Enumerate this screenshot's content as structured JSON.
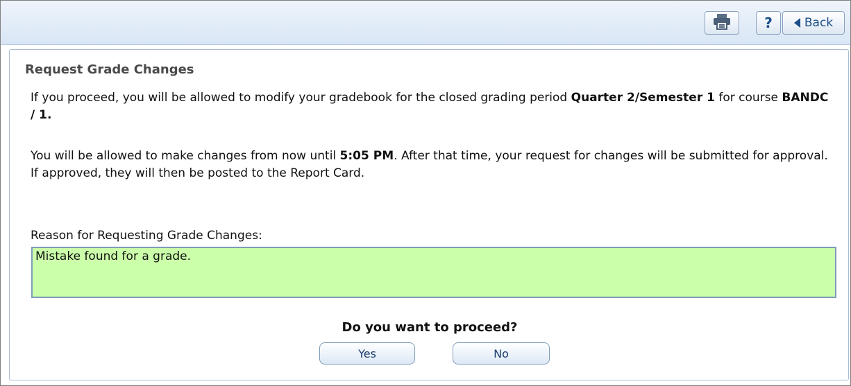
{
  "toolbar": {
    "print_icon": "printer-icon",
    "help_label": "?",
    "back_label": "Back"
  },
  "panel": {
    "title": "Request Grade Changes",
    "paragraph1": {
      "text_a": "If you proceed, you will be allowed to modify your gradebook for the closed grading period ",
      "period": "Quarter 2/Semester 1",
      "text_b": " for course ",
      "course": "BANDC / 1."
    },
    "paragraph2": {
      "text_a": "You will be allowed to make changes from now until ",
      "time": "5:05 PM",
      "text_b": ". After that time, your request for changes will be submitted for approval. If approved, they will then be posted to the Report Card."
    },
    "reason_label": "Reason for Requesting Grade Changes:",
    "reason_value": "Mistake found for a grade.",
    "question": "Do you want to proceed?",
    "yes_label": "Yes",
    "no_label": "No"
  },
  "colors": {
    "reason_field_bg": "#ccffaa",
    "toolbar_bg": "#d9e6f5",
    "accent": "#1a4e8a"
  }
}
